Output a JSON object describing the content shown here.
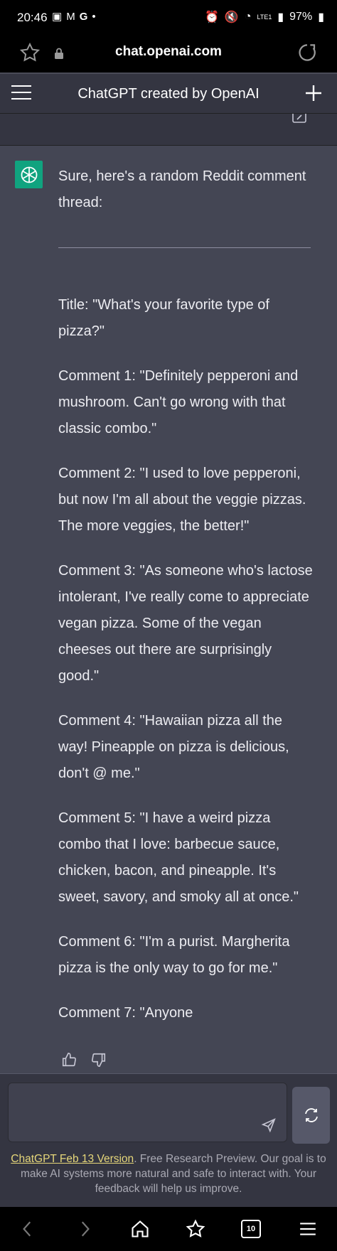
{
  "status_bar": {
    "time": "20:46",
    "battery": "97%",
    "network": "LTE1"
  },
  "browser": {
    "url": "chat.openai.com",
    "tab_count": "10"
  },
  "header": {
    "title": "ChatGPT created by OpenAI"
  },
  "message": {
    "intro": "Sure, here's a random Reddit comment thread:",
    "title_line": "Title: \"What's your favorite type of pizza?\"",
    "comments": [
      "Comment 1: \"Definitely pepperoni and mushroom. Can't go wrong with that classic combo.\"",
      "Comment 2: \"I used to love pepperoni, but now I'm all about the veggie pizzas. The more veggies, the better!\"",
      "Comment 3: \"As someone who's lactose intolerant, I've really come to appreciate vegan pizza. Some of the vegan cheeses out there are surprisingly good.\"",
      "Comment 4: \"Hawaiian pizza all the way! Pineapple on pizza is delicious, don't @ me.\"",
      "Comment 5: \"I have a weird pizza combo that I love: barbecue sauce, chicken, bacon, and pineapple. It's sweet, savory, and smoky all at once.\"",
      "Comment 6: \"I'm a purist. Margherita pizza is the only way to go for me.\"",
      "Comment 7: \"Anyone"
    ]
  },
  "input": {
    "placeholder": ""
  },
  "footer": {
    "link_text": "ChatGPT Feb 13 Version",
    "text": ". Free Research Preview. Our goal is to make AI systems more natural and safe to interact with. Your feedback will help us improve."
  },
  "colors": {
    "accent": "#10a37f",
    "message_bg": "#444654",
    "page_bg": "#343541",
    "footer_link": "#e6d77a"
  }
}
